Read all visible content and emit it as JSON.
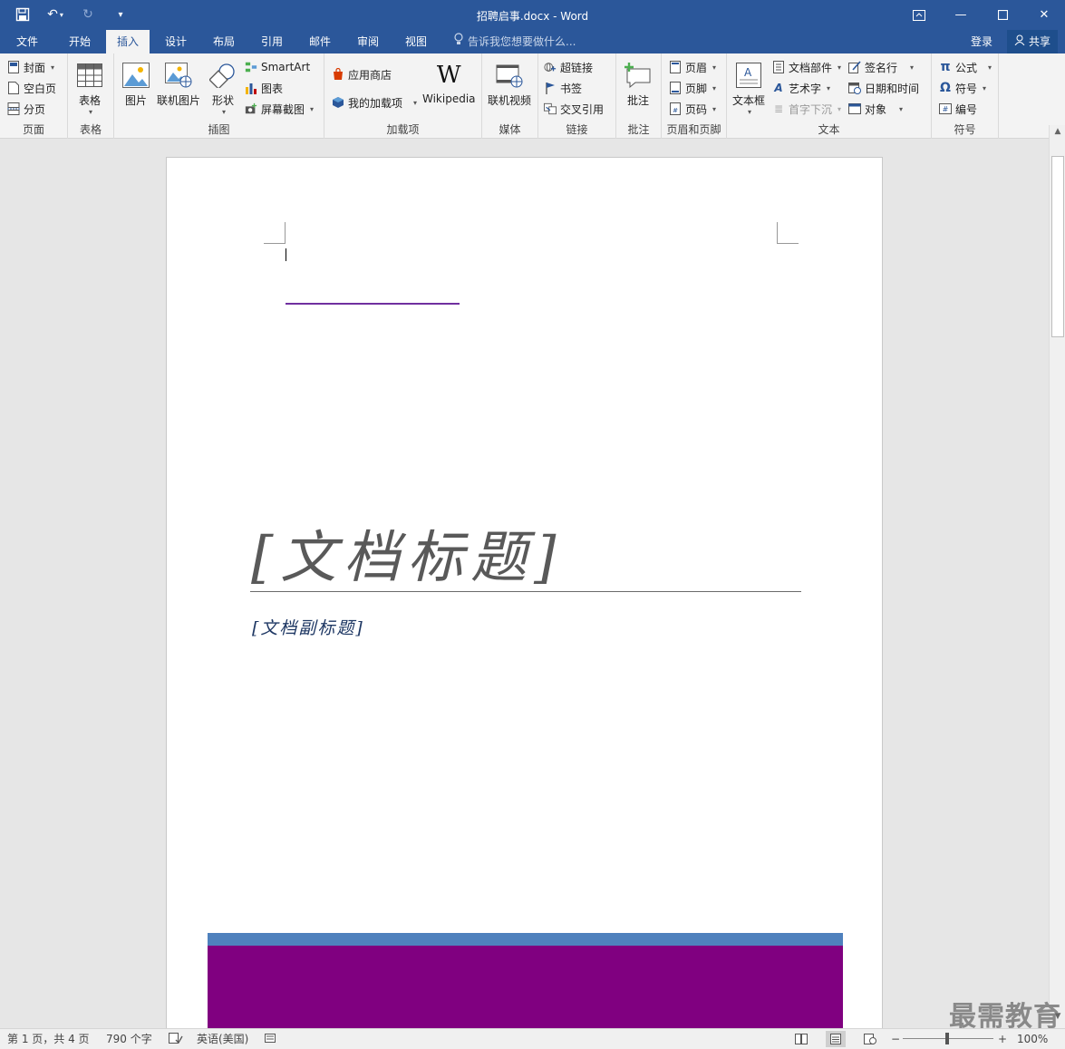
{
  "titlebar": {
    "document_title": "招聘启事.docx - Word",
    "qat": {
      "save_icon": "save-icon",
      "undo_icon": "undo-icon",
      "redo_icon": "redo-icon",
      "customize_icon": "customize-qat-icon"
    }
  },
  "tabs": [
    {
      "label": "文件"
    },
    {
      "label": "开始"
    },
    {
      "label": "插入"
    },
    {
      "label": "设计"
    },
    {
      "label": "布局"
    },
    {
      "label": "引用"
    },
    {
      "label": "邮件"
    },
    {
      "label": "审阅"
    },
    {
      "label": "视图"
    }
  ],
  "active_tab": "插入",
  "tellme": "告诉我您想要做什么...",
  "account": {
    "login": "登录",
    "share": "共享"
  },
  "ribbon": {
    "pages": {
      "label": "页面",
      "cover": "封面",
      "blank_page": "空白页",
      "page_break": "分页"
    },
    "tables": {
      "label": "表格",
      "table": "表格"
    },
    "illustrations": {
      "label": "插图",
      "picture": "图片",
      "online_picture": "联机图片",
      "shapes": "形状",
      "smartart": "SmartArt",
      "chart": "图表",
      "screenshot": "屏幕截图"
    },
    "addins": {
      "label": "加载项",
      "store": "应用商店",
      "my_addins": "我的加载项",
      "wikipedia": "Wikipedia"
    },
    "media": {
      "label": "媒体",
      "online_video": "联机视频"
    },
    "links": {
      "label": "链接",
      "hyperlink": "超链接",
      "bookmark": "书签",
      "cross_reference": "交叉引用"
    },
    "comments": {
      "label": "批注",
      "comment": "批注"
    },
    "header_footer": {
      "label": "页眉和页脚",
      "header": "页眉",
      "footer": "页脚",
      "page_number": "页码"
    },
    "text": {
      "label": "文本",
      "textbox": "文本框",
      "quick_parts": "文档部件",
      "wordart": "艺术字",
      "drop_cap": "首字下沉",
      "signature_line": "签名行",
      "date_time": "日期和时间",
      "object": "对象"
    },
    "symbols": {
      "label": "符号",
      "equation": "公式",
      "symbol": "符号",
      "number": "编号"
    }
  },
  "document": {
    "title_placeholder": "[文档标题]",
    "subtitle_placeholder": "[文档副标题]"
  },
  "statusbar": {
    "page_info": "第 1 页，共 4 页",
    "word_count": "790 个字",
    "language": "英语(美国)",
    "zoom": "100%"
  },
  "watermark": "最需教育",
  "colors": {
    "titlebar": "#2b579a",
    "band_blue": "#4f81bd",
    "band_purple": "#800080",
    "rule_purple": "#7030a0"
  }
}
